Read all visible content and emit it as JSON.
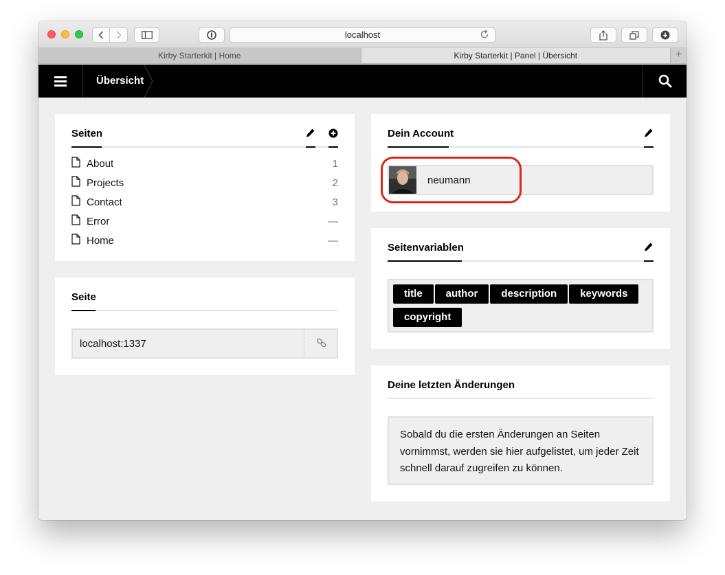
{
  "browser": {
    "url": "localhost",
    "tabs": [
      {
        "label": "Kirby Starterkit | Home"
      },
      {
        "label": "Kirby Starterkit | Panel | Übersicht"
      }
    ],
    "new_tab_label": "+"
  },
  "nav": {
    "breadcrumb": "Übersicht"
  },
  "pages_card": {
    "title": "Seiten",
    "items": [
      {
        "name": "About",
        "num": "1"
      },
      {
        "name": "Projects",
        "num": "2"
      },
      {
        "name": "Contact",
        "num": "3"
      },
      {
        "name": "Error",
        "num": "—"
      },
      {
        "name": "Home",
        "num": "—"
      }
    ]
  },
  "site_card": {
    "title": "Seite",
    "url": "localhost:1337"
  },
  "account_card": {
    "title": "Dein Account",
    "username": "neumann"
  },
  "variables_card": {
    "title": "Seitenvariablen",
    "tags": [
      "title",
      "author",
      "description",
      "keywords",
      "copyright"
    ]
  },
  "changes_card": {
    "title": "Deine letzten Änderungen",
    "text": "Sobald du die ersten Änderungen an Seiten vornimmst, werden sie hier aufgelistet, um jeder Zeit schnell darauf zugreifen zu können."
  },
  "colors": {
    "accent": "#000000",
    "background": "#efefef",
    "highlight": "#d9261c"
  }
}
